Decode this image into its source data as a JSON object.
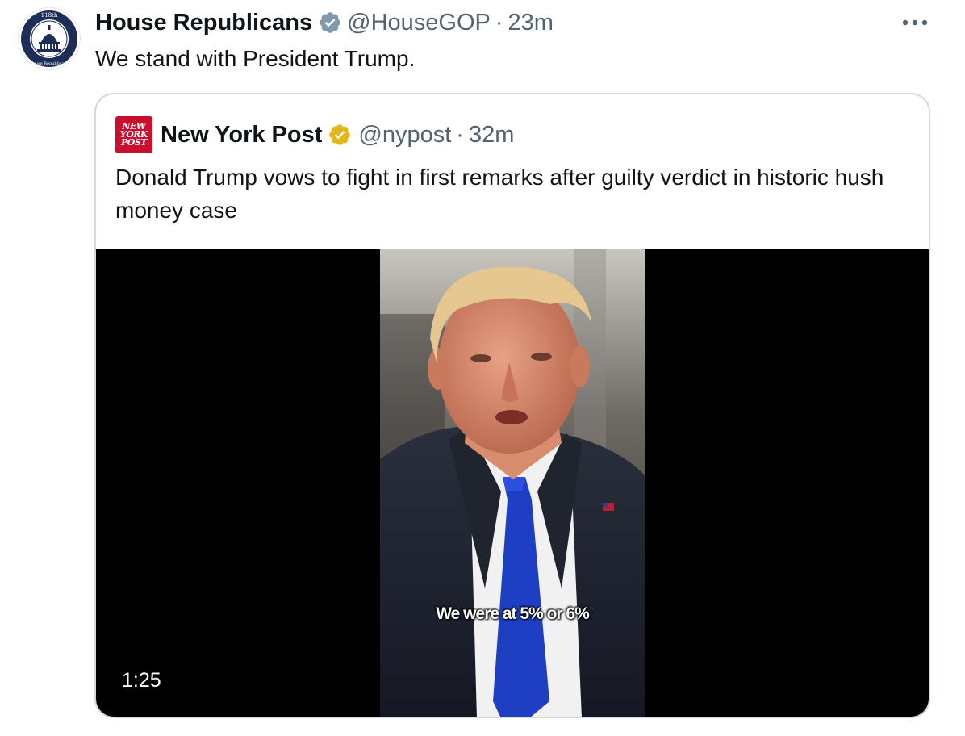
{
  "tweet": {
    "display_name": "House Republicans",
    "handle": "@HouseGOP",
    "separator": "·",
    "time": "23m",
    "text": "We stand with President Trump.",
    "avatar": {
      "seal_top": "118th",
      "seal_bottom": "House Republicans"
    },
    "verified_badge_color": "#829aab",
    "more_icon": "more-horizontal-icon"
  },
  "quote": {
    "display_name": "New York Post",
    "handle": "@nypost",
    "separator": "·",
    "time": "32m",
    "text": "Donald Trump vows to fight in first remarks after guilty verdict in historic hush money case",
    "logo_lines": [
      "NEW",
      "YORK",
      "POST"
    ],
    "verified_badge_color": "#e2b719",
    "video": {
      "caption": "We were at 5% or 6%",
      "duration": "1:25"
    }
  },
  "colors": {
    "text_primary": "#0f1419",
    "text_secondary": "#536471",
    "card_border": "#cfd9de",
    "nyp_red": "#c8102e",
    "tie_blue": "#1e3fc4"
  }
}
